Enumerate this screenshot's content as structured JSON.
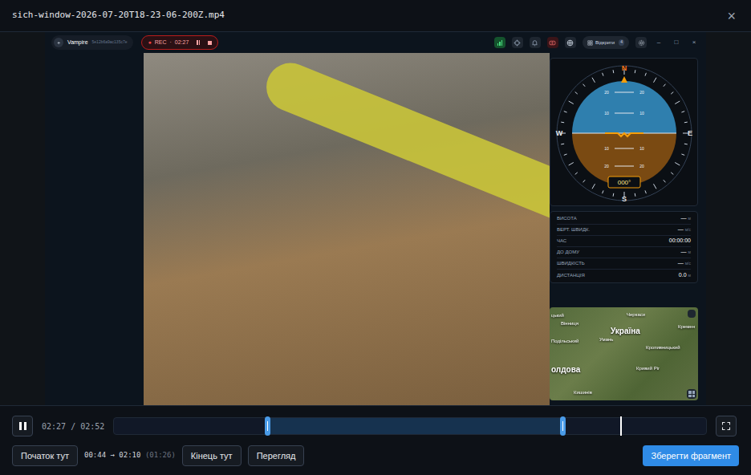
{
  "window": {
    "title": "sich-window-2026-07-20T18-23-06-200Z.mp4",
    "close": "×"
  },
  "recording": {
    "vehicle": {
      "name": "Vampire",
      "id": "5e12b6a9ac135c7e"
    },
    "rec": {
      "dot": "●",
      "label": "REC",
      "separator": "·",
      "time": "02:27"
    },
    "open_button": {
      "label": "Відкрити",
      "count": "4"
    },
    "window_controls": [
      "–",
      "□",
      "×"
    ],
    "compass": {
      "north": "N",
      "south": "S",
      "west": "W",
      "east": "E",
      "heading": "000°",
      "ladder": [
        "20",
        "10",
        "10",
        "20"
      ]
    },
    "telemetry": [
      {
        "label": "ВИСОТА",
        "value": "—",
        "unit": "м"
      },
      {
        "label": "ВЕРТ. ШВИДК.",
        "value": "—",
        "unit": "м/с"
      },
      {
        "label": "ЧАС",
        "value": "00:00:00",
        "unit": ""
      },
      {
        "label": "ДО ДОМУ",
        "value": "—",
        "unit": "м"
      },
      {
        "label": "ШВИДКІСТЬ",
        "value": "—",
        "unit": "м/с"
      },
      {
        "label": "ДИСТАНЦІЯ",
        "value": "0.0",
        "unit": "м"
      }
    ],
    "map": {
      "labels": [
        {
          "text": "цький",
          "kind": "city"
        },
        {
          "text": "Вінниця",
          "kind": "city"
        },
        {
          "text": "Черкаси",
          "kind": "city"
        },
        {
          "text": "Україна",
          "kind": "country"
        },
        {
          "text": "Кремен",
          "kind": "city"
        },
        {
          "text": "Подільський",
          "kind": "city"
        },
        {
          "text": "Умань",
          "kind": "city"
        },
        {
          "text": "Кропивницький",
          "kind": "city"
        },
        {
          "text": "олдова",
          "kind": "country"
        },
        {
          "text": "Кривий Ріг",
          "kind": "city"
        },
        {
          "text": "Кишинів",
          "kind": "city"
        }
      ]
    }
  },
  "player": {
    "playing": true,
    "current": "02:27",
    "separator": "/",
    "total": "02:52",
    "selection_start": 0.259,
    "selection_end": 0.758,
    "playhead": 0.855
  },
  "actions": {
    "start": "Початок тут",
    "range": "00:44 → 02:10",
    "duration": "(01:26)",
    "end": "Кінець тут",
    "preview": "Перегляд",
    "save": "Зберегти фрагмент"
  }
}
